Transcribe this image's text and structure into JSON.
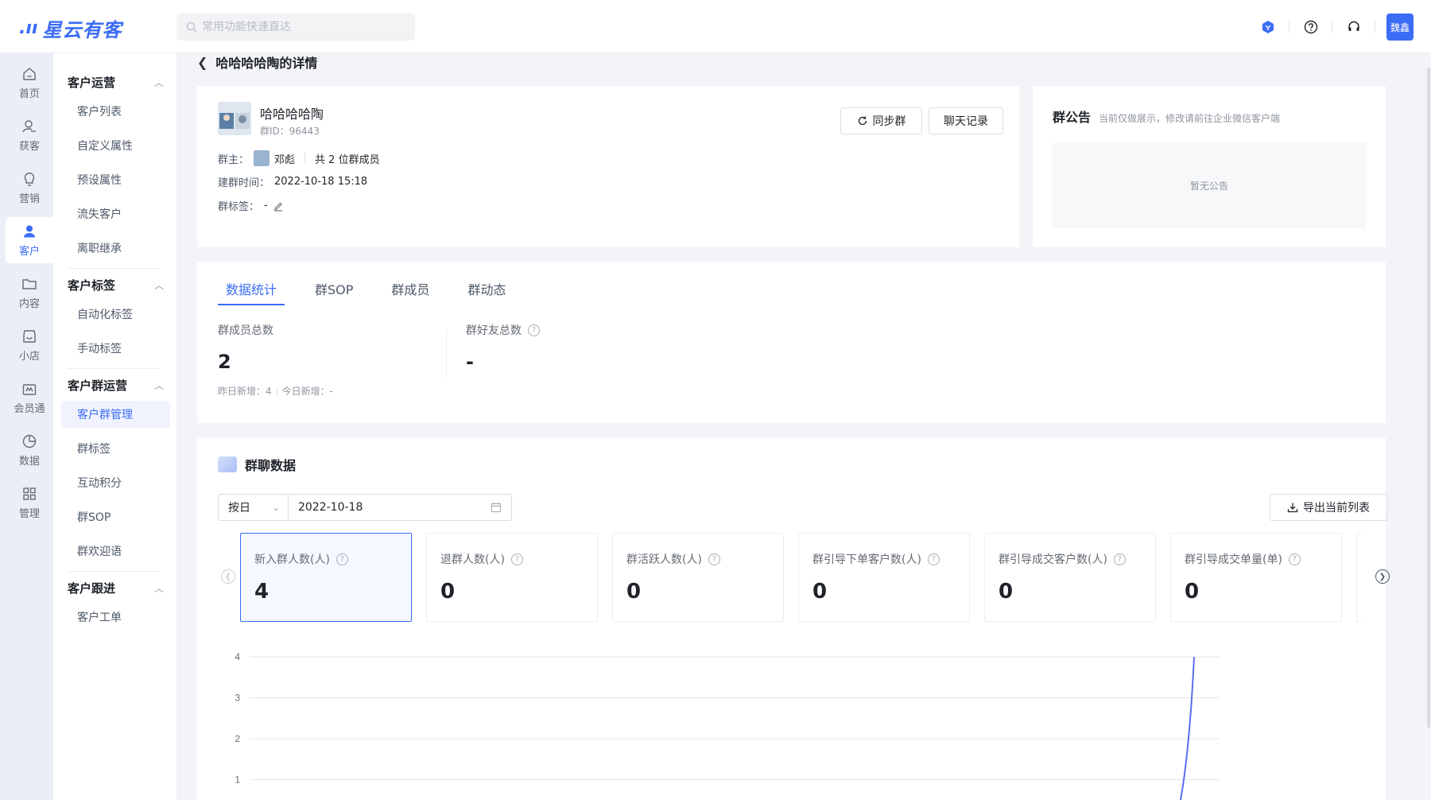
{
  "app": {
    "brand": "星云有客"
  },
  "search": {
    "placeholder": "常用功能快速直达"
  },
  "header": {
    "user_avatar_text": "魏鑫"
  },
  "rail": [
    {
      "label": "首页",
      "icon": "home-icon"
    },
    {
      "label": "获客",
      "icon": "user-add-icon"
    },
    {
      "label": "营销",
      "icon": "bulb-icon"
    },
    {
      "label": "客户",
      "icon": "user-icon",
      "active": true
    },
    {
      "label": "内容",
      "icon": "folder-icon"
    },
    {
      "label": "小店",
      "icon": "shop-icon"
    },
    {
      "label": "会员通",
      "icon": "crown-icon"
    },
    {
      "label": "数据",
      "icon": "pie-chart-icon"
    },
    {
      "label": "管理",
      "icon": "apps-icon"
    }
  ],
  "subnav": {
    "groups": [
      {
        "title": "客户运营",
        "items": [
          "客户列表",
          "自定义属性",
          "预设属性",
          "流失客户",
          "离职继承"
        ]
      },
      {
        "title": "客户标签",
        "items": [
          "自动化标签",
          "手动标签"
        ]
      },
      {
        "title": "客户群运营",
        "items": [
          "客户群管理",
          "群标签",
          "互动积分",
          "群SOP",
          "群欢迎语"
        ]
      },
      {
        "title": "客户跟进",
        "items": [
          "客户工单"
        ]
      }
    ],
    "active_item": "客户群管理"
  },
  "page": {
    "title": "哈哈哈哈陶的详情"
  },
  "group_info": {
    "name": "哈哈哈哈陶",
    "id_label": "群ID：",
    "id": "96443",
    "sync_label": "同步群",
    "chat_label": "聊天记录",
    "owner_label": "群主：",
    "owner_name": "邓彪",
    "member_count_text": "共 2 位群成员",
    "created_label": "建群时间：",
    "created_time": "2022-10-18 15:18",
    "tag_label": "群标签：",
    "tag_value": "-"
  },
  "notice": {
    "title": "群公告",
    "hint": "当前仅做展示，修改请前往企业微信客户端",
    "empty_text": "暂无公告"
  },
  "tabs": [
    "数据统计",
    "群SOP",
    "群成员",
    "群动态"
  ],
  "stats": {
    "members": {
      "label": "群成员总数",
      "value": "2",
      "yesterday_label": "昨日新增：",
      "yesterday": "4",
      "today_label": "今日新增：",
      "today": "-"
    },
    "friends": {
      "label": "群好友总数",
      "value": "-"
    }
  },
  "chart_section": {
    "title": "群聊数据",
    "unit_select": "按日",
    "date": "2022-10-18",
    "export_label": "导出当前列表",
    "metrics": [
      {
        "label": "新入群人数(人)",
        "value": "4",
        "active": true
      },
      {
        "label": "退群人数(人)",
        "value": "0"
      },
      {
        "label": "群活跃人数(人)",
        "value": "0"
      },
      {
        "label": "群引导下单客户数(人)",
        "value": "0"
      },
      {
        "label": "群引导成交客户数(人)",
        "value": "0"
      },
      {
        "label": "群引导成交单量(单)",
        "value": "0"
      }
    ]
  },
  "chart_data": {
    "type": "line",
    "y_ticks": [
      "4",
      "3",
      "2",
      "1"
    ],
    "ylim": [
      0,
      4
    ],
    "grid": true,
    "series": [
      {
        "color": "#5b6cf0",
        "x": [
          0.0,
          1.0
        ],
        "values": [
          0,
          4
        ]
      }
    ]
  },
  "colors": {
    "accent": "#3b6cf6"
  }
}
